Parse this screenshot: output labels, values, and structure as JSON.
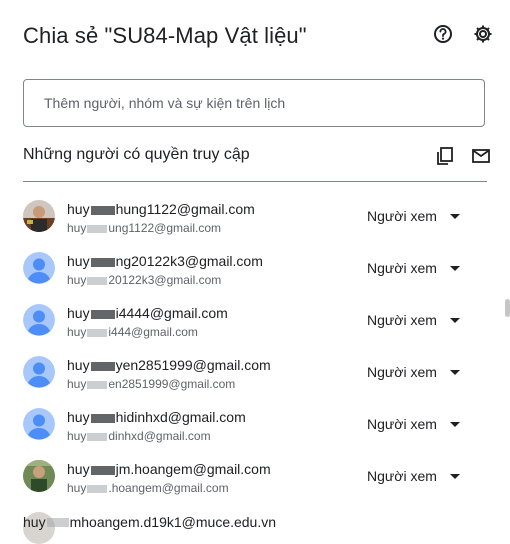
{
  "dialog": {
    "title": "Chia sẻ \"SU84-Map Vật liệu\"",
    "help_icon": "help-circle-icon",
    "settings_icon": "gear-icon"
  },
  "add_people": {
    "placeholder": "Thêm người, nhóm và sự kiện trên lịch"
  },
  "access_section": {
    "title": "Những người có quyền truy cập",
    "copy_icon": "copy-icon",
    "mail_icon": "mail-icon"
  },
  "people": [
    {
      "name_start": "huy",
      "name_end": "hung1122@gmail.com",
      "email_start": "huy",
      "email_end": "ung1122@gmail.com",
      "role": "Người xem",
      "avatar": "photo"
    },
    {
      "name_start": "huy",
      "name_end": "ng20122k3@gmail.com",
      "email_start": "huy",
      "email_end": "20122k3@gmail.com",
      "role": "Người xem",
      "avatar": "default"
    },
    {
      "name_start": "huy",
      "name_end": "i4444@gmail.com",
      "email_start": "huy",
      "email_end": "i444@gmail.com",
      "role": "Người xem",
      "avatar": "default"
    },
    {
      "name_start": "huy",
      "name_end": "yen2851999@gmail.com",
      "email_start": "huy",
      "email_end": "en2851999@gmail.com",
      "role": "Người xem",
      "avatar": "default"
    },
    {
      "name_start": "huy",
      "name_end": "hidinhxd@gmail.com",
      "email_start": "huy",
      "email_end": "dinhxd@gmail.com",
      "role": "Người xem",
      "avatar": "default"
    },
    {
      "name_start": "huy",
      "name_end": "jm.hoangem@gmail.com",
      "email_start": "huy",
      "email_end": ".hoangem@gmail.com",
      "role": "Người xem",
      "avatar": "photo2"
    }
  ],
  "partial_row": {
    "name_start": "huy",
    "name_end": "mhoangem.d19k1@muce.edu.vn"
  },
  "colors": {
    "default_avatar_bg": "#a8c7fa",
    "default_avatar_fg": "#4c8df6",
    "text_primary": "#202124",
    "text_secondary": "#5f6368"
  }
}
